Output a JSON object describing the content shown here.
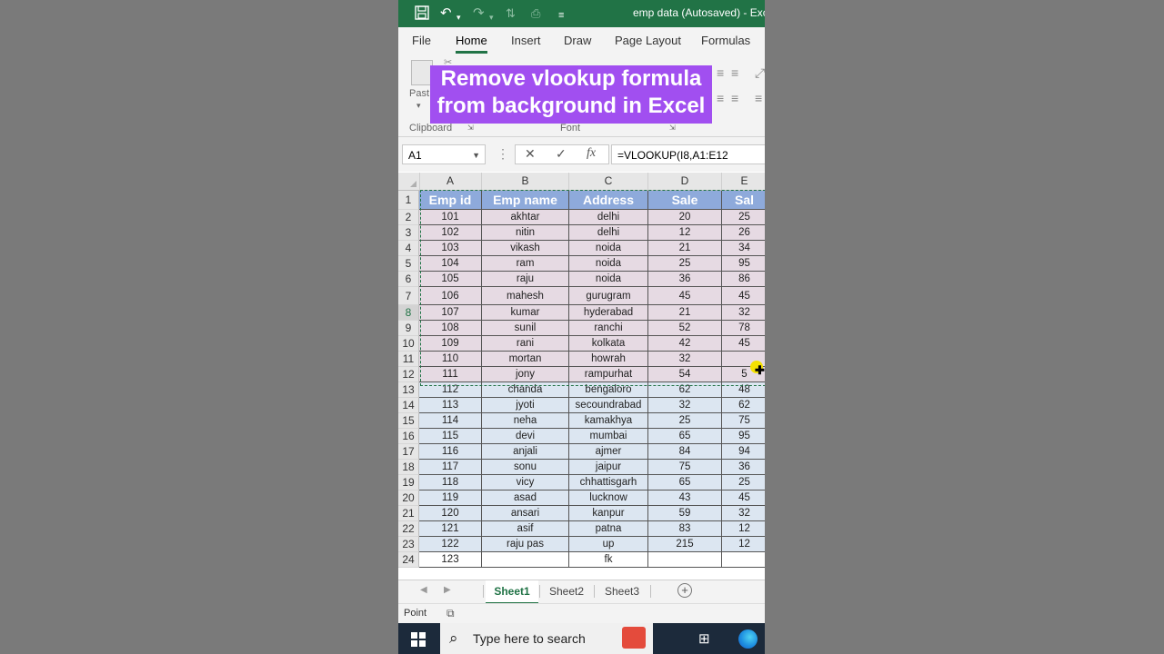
{
  "app": {
    "window_title": "emp data (Autosaved)  -  Exc",
    "quick_access": [
      "save-icon",
      "undo-icon",
      "redo-icon",
      "sort-icon",
      "printer-icon",
      "customize-icon"
    ]
  },
  "ribbon": {
    "tabs": [
      "File",
      "Home",
      "Insert",
      "Draw",
      "Page Layout",
      "Formulas"
    ],
    "active_tab": "Home",
    "paste_label": "Past",
    "groups": [
      "Clipboard",
      "Font"
    ],
    "banner_line1": "Remove vlookup formula",
    "banner_line2": "from background in Excel"
  },
  "formula_bar": {
    "name_box": "A1",
    "cancel_symbol": "✕",
    "enter_symbol": "✓",
    "fx_symbol": "fx",
    "formula": "=VLOOKUP(I8,A1:E12"
  },
  "sheet": {
    "columns": [
      "A",
      "B",
      "C",
      "D",
      "E"
    ],
    "header_row": [
      "Emp id",
      "Emp name",
      "Address",
      "Sale",
      "Sal"
    ],
    "rows": [
      {
        "n": "2",
        "cells": [
          "101",
          "akhtar",
          "delhi",
          "20",
          "25"
        ]
      },
      {
        "n": "3",
        "cells": [
          "102",
          "nitin",
          "delhi",
          "12",
          "26"
        ]
      },
      {
        "n": "4",
        "cells": [
          "103",
          "vikash",
          "noida",
          "21",
          "34"
        ]
      },
      {
        "n": "5",
        "cells": [
          "104",
          "ram",
          "noida",
          "25",
          "95"
        ]
      },
      {
        "n": "6",
        "cells": [
          "105",
          "raju",
          "noida",
          "36",
          "86"
        ]
      },
      {
        "n": "7",
        "cells": [
          "106",
          "mahesh",
          "gurugram",
          "45",
          "45"
        ]
      },
      {
        "n": "8",
        "cells": [
          "107",
          "kumar",
          "hyderabad",
          "21",
          "32"
        ]
      },
      {
        "n": "9",
        "cells": [
          "108",
          "sunil",
          "ranchi",
          "52",
          "78"
        ]
      },
      {
        "n": "10",
        "cells": [
          "109",
          "rani",
          "kolkata",
          "42",
          "45"
        ]
      },
      {
        "n": "11",
        "cells": [
          "110",
          "mortan",
          "howrah",
          "32",
          ""
        ]
      },
      {
        "n": "12",
        "cells": [
          "111",
          "jony",
          "rampurhat",
          "54",
          "5"
        ]
      },
      {
        "n": "13",
        "cells": [
          "112",
          "chanda",
          "bengaloro",
          "62",
          "48"
        ]
      },
      {
        "n": "14",
        "cells": [
          "113",
          "jyoti",
          "secoundrabad",
          "32",
          "62"
        ]
      },
      {
        "n": "15",
        "cells": [
          "114",
          "neha",
          "kamakhya",
          "25",
          "75"
        ]
      },
      {
        "n": "16",
        "cells": [
          "115",
          "devi",
          "mumbai",
          "65",
          "95"
        ]
      },
      {
        "n": "17",
        "cells": [
          "116",
          "anjali",
          "ajmer",
          "84",
          "94"
        ]
      },
      {
        "n": "18",
        "cells": [
          "117",
          "sonu",
          "jaipur",
          "75",
          "36"
        ]
      },
      {
        "n": "19",
        "cells": [
          "118",
          "vicy",
          "chhattisgarh",
          "65",
          "25"
        ]
      },
      {
        "n": "20",
        "cells": [
          "119",
          "asad",
          "lucknow",
          "43",
          "45"
        ]
      },
      {
        "n": "21",
        "cells": [
          "120",
          "ansari",
          "kanpur",
          "59",
          "32"
        ]
      },
      {
        "n": "22",
        "cells": [
          "121",
          "asif",
          "patna",
          "83",
          "12"
        ]
      },
      {
        "n": "23",
        "cells": [
          "122",
          "raju pas",
          "up",
          "215",
          "12"
        ]
      },
      {
        "n": "24",
        "cells": [
          "123",
          "",
          "fk",
          "",
          ""
        ]
      }
    ]
  },
  "sheet_tabs": [
    "Sheet1",
    "Sheet2",
    "Sheet3"
  ],
  "active_sheet": "Sheet1",
  "status": {
    "mode": "Point"
  },
  "taskbar": {
    "search_placeholder": "Type here to search"
  },
  "colors": {
    "excel_green": "#217346",
    "header_fill": "#8eaadb",
    "banner": "#a14ff0",
    "pink_fill": "#e6dae3",
    "blue_fill": "#dce6f1"
  }
}
